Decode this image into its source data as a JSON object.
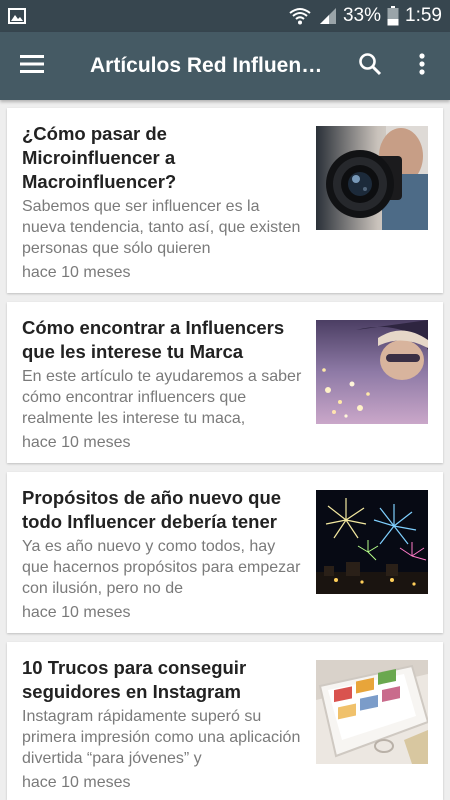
{
  "status_bar": {
    "battery_percent": "33%",
    "time": "1:59",
    "icons": [
      "gallery-icon",
      "wifi-icon",
      "signal-icon",
      "battery-icon"
    ]
  },
  "app_bar": {
    "title": "Artículos Red Influencers",
    "icons": [
      "hamburger-menu-icon",
      "search-icon",
      "more-vert-icon"
    ]
  },
  "articles": [
    {
      "title": "¿Cómo pasar de Microinfluencer a Macroinfluencer?",
      "excerpt": "Sabemos que ser influencer es la nueva tendencia, tanto así, que existen personas que sólo quieren",
      "date": "hace 10 meses",
      "thumbnail": "camera-lens-photo"
    },
    {
      "title": "Cómo encontrar a Influencers que les interese tu Marca",
      "excerpt": "En este artículo te ayudaremos a saber cómo encontrar influencers que realmente les interese tu maca,",
      "date": "hace 10 meses",
      "thumbnail": "woman-with-lights-photo"
    },
    {
      "title": "Propósitos de año nuevo que todo Influencer debería tener",
      "excerpt": "Ya es año nuevo y como todos, hay que hacernos propósitos para empezar con ilusión, pero no de",
      "date": "hace 10 meses",
      "thumbnail": "fireworks-photo"
    },
    {
      "title": "10 Trucos para conseguir seguidores en Instagram",
      "excerpt": "Instagram rápidamente superó su primera impresión como una aplicación divertida “para jóvenes” y",
      "date": "hace 10 meses",
      "thumbnail": "phone-instagram-photo"
    }
  ],
  "colors": {
    "status_bar": "#37464f",
    "app_bar": "#455a64",
    "background": "#eeeeee",
    "card": "#ffffff",
    "title_text": "#222222",
    "secondary_text": "#7a7a7a"
  }
}
